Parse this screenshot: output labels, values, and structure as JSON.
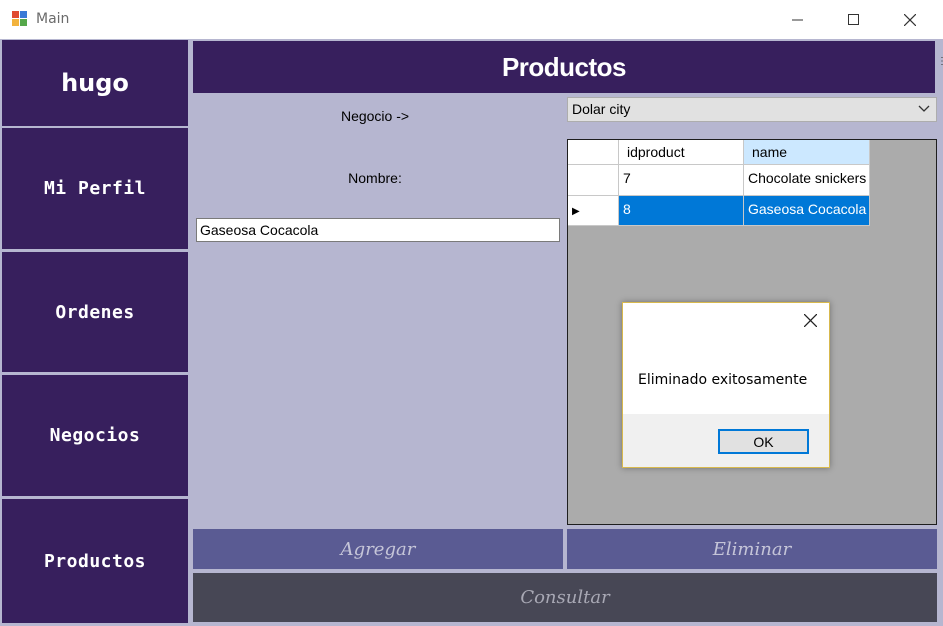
{
  "window": {
    "title": "Main"
  },
  "sidebar": {
    "user": "hugo",
    "items": [
      {
        "label": "Mi Perfil"
      },
      {
        "label": "Ordenes"
      },
      {
        "label": "Negocios"
      },
      {
        "label": "Productos"
      }
    ]
  },
  "header": {
    "title": "Productos"
  },
  "form": {
    "negocio_label": "Negocio ->",
    "negocio_selected": "Dolar city",
    "nombre_label": "Nombre:",
    "nombre_value": "Gaseosa Cocacola"
  },
  "grid": {
    "columns": [
      "idproduct",
      "name"
    ],
    "rows": [
      {
        "idproduct": "7",
        "name": "Chocolate snickers"
      },
      {
        "idproduct": "8",
        "name": "Gaseosa Cocacola"
      }
    ],
    "selected_row_marker": "▶"
  },
  "dialog": {
    "message": "Eliminado exitosamente",
    "ok_label": "OK"
  },
  "buttons": {
    "agregar": "Agregar",
    "eliminar": "Eliminar",
    "consultar": "Consultar"
  },
  "colors": {
    "sidebar": "#371f5d",
    "panel": "#b6b6d0",
    "selection": "#0078d7",
    "button": "#5a5b93",
    "consultar": "#474755"
  }
}
